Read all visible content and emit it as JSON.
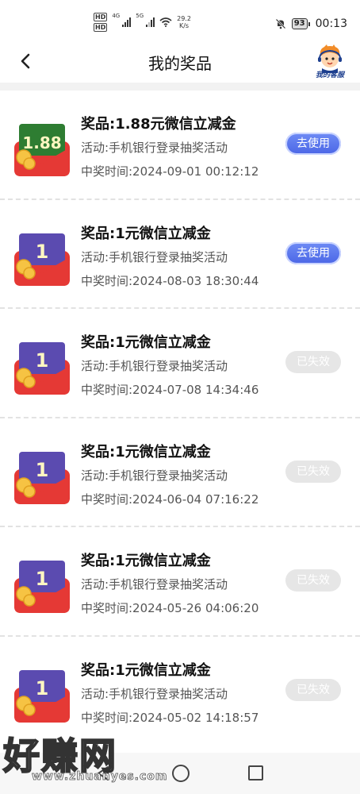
{
  "status_bar": {
    "hd_top": "HD",
    "hd_bottom": "HD",
    "net_1": "4G",
    "net_2": "5G",
    "speed_value": "29.2",
    "speed_unit": "K/s",
    "battery": "93",
    "time": "00:13"
  },
  "header": {
    "title": "我的奖品",
    "service_label": "我的客服",
    "back_icon": "chevron-left-icon"
  },
  "colors": {
    "accent": "#4b66e6",
    "expired": "#e6e6e6",
    "envelope_red": "#e53935",
    "note_green": "#2e7d32",
    "note_purple": "#5b4bb0"
  },
  "prizes": [
    {
      "prize": "奖品:1.88元微信立减金",
      "activity": "活动:手机银行登录抽奖活动",
      "time": "中奖时间:2024-09-01 00:12:12",
      "button": "去使用",
      "status": "active",
      "amount": "1.88",
      "note_color": "green"
    },
    {
      "prize": "奖品:1元微信立减金",
      "activity": "活动:手机银行登录抽奖活动",
      "time": "中奖时间:2024-08-03 18:30:44",
      "button": "去使用",
      "status": "active",
      "amount": "1",
      "note_color": "purple"
    },
    {
      "prize": "奖品:1元微信立减金",
      "activity": "活动:手机银行登录抽奖活动",
      "time": "中奖时间:2024-07-08 14:34:46",
      "button": "已失效",
      "status": "expired",
      "amount": "1",
      "note_color": "purple"
    },
    {
      "prize": "奖品:1元微信立减金",
      "activity": "活动:手机银行登录抽奖活动",
      "time": "中奖时间:2024-06-04 07:16:22",
      "button": "已失效",
      "status": "expired",
      "amount": "1",
      "note_color": "purple"
    },
    {
      "prize": "奖品:1元微信立减金",
      "activity": "活动:手机银行登录抽奖活动",
      "time": "中奖时间:2024-05-26 04:06:20",
      "button": "已失效",
      "status": "expired",
      "amount": "1",
      "note_color": "purple"
    },
    {
      "prize": "奖品:1元微信立减金",
      "activity": "活动:手机银行登录抽奖活动",
      "time": "中奖时间:2024-05-02 14:18:57",
      "button": "已失效",
      "status": "expired",
      "amount": "1",
      "note_color": "purple"
    }
  ],
  "watermark": {
    "main": "好赚网",
    "sub": "www.zhuanyes.com"
  },
  "system_nav": {
    "back": "triangle-back-icon",
    "home": "circle-home-icon",
    "recent": "square-recent-icon"
  }
}
